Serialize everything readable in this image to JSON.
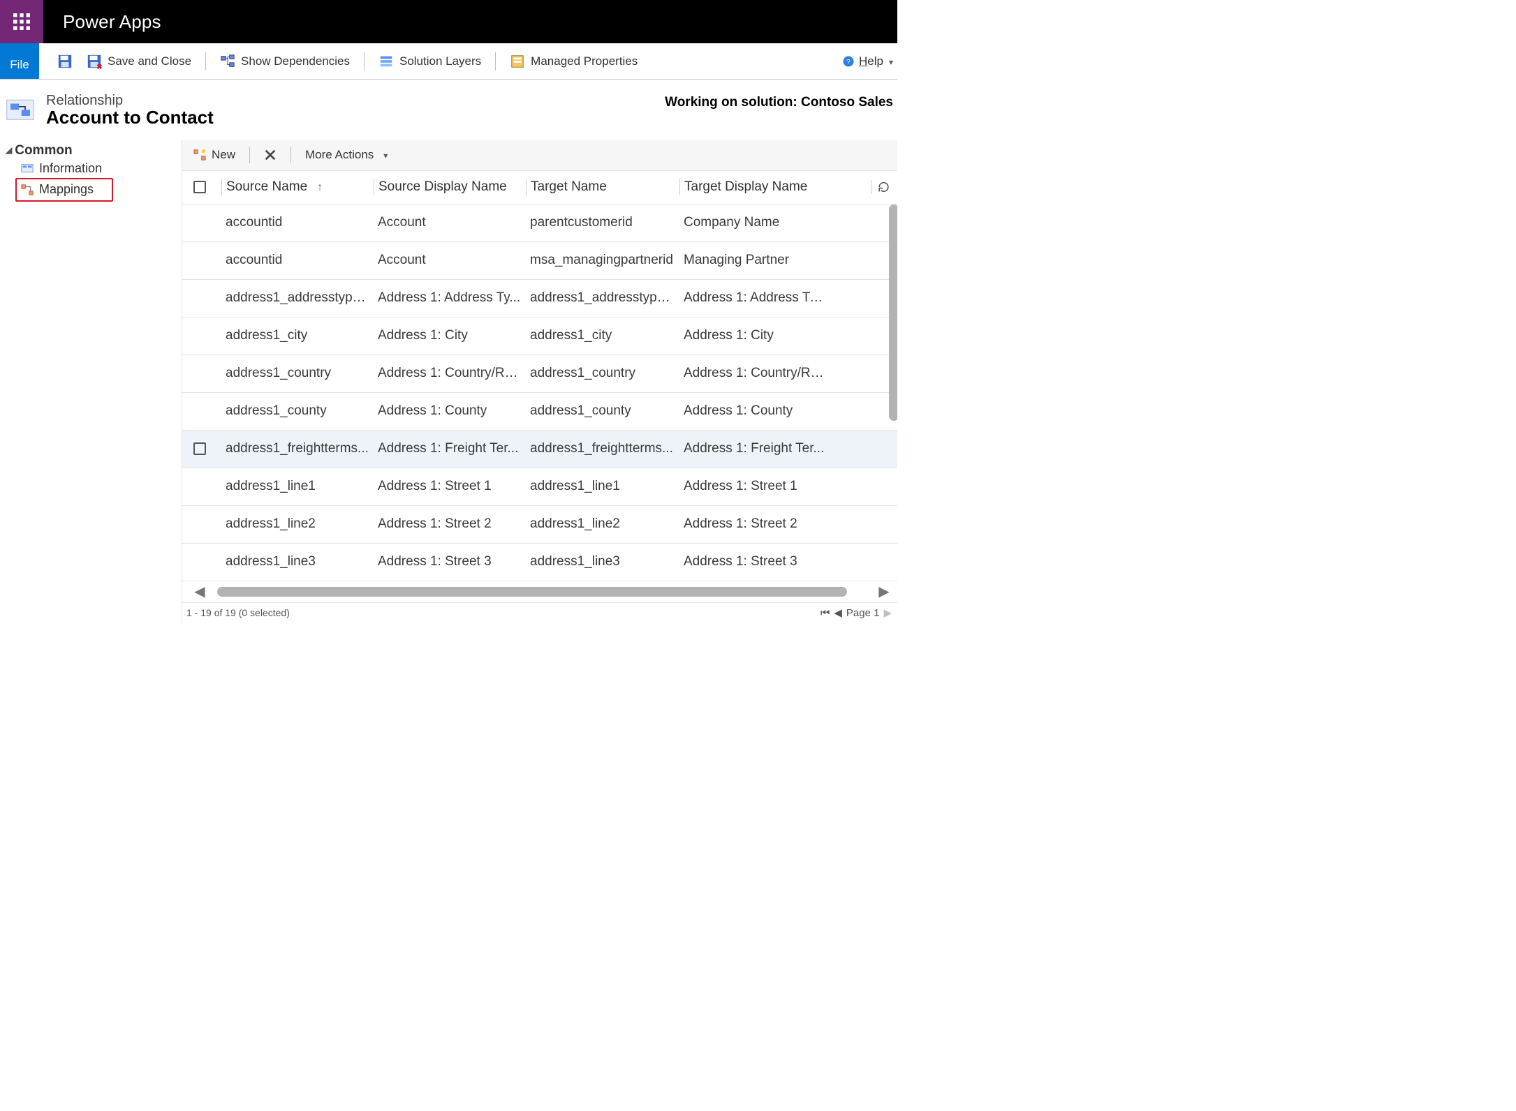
{
  "app_title": "Power Apps",
  "ribbon": {
    "file": "File",
    "save": "",
    "save_close": "Save and Close",
    "deps": "Show Dependencies",
    "layers": "Solution Layers",
    "props": "Managed Properties",
    "help": "Help"
  },
  "header": {
    "subtitle": "Relationship",
    "title": "Account to Contact",
    "solution_prefix": "Working on solution: ",
    "solution_name": "Contoso Sales"
  },
  "nav": {
    "group": "Common",
    "items": [
      "Information",
      "Mappings"
    ],
    "selected": 1
  },
  "grid_toolbar": {
    "new": "New",
    "more": "More Actions"
  },
  "grid": {
    "columns": [
      "Source Name",
      "Source Display Name",
      "Target Name",
      "Target Display Name"
    ],
    "sort_col": 0,
    "rows": [
      {
        "sn": "accountid",
        "sdn": "Account",
        "tn": "parentcustomerid",
        "tdn": "Company Name"
      },
      {
        "sn": "accountid",
        "sdn": "Account",
        "tn": "msa_managingpartnerid",
        "tdn": "Managing Partner"
      },
      {
        "sn": "address1_addresstype...",
        "sdn": "Address 1: Address Ty...",
        "tn": "address1_addresstype...",
        "tdn": "Address 1: Address Ty..."
      },
      {
        "sn": "address1_city",
        "sdn": "Address 1: City",
        "tn": "address1_city",
        "tdn": "Address 1: City"
      },
      {
        "sn": "address1_country",
        "sdn": "Address 1: Country/Re...",
        "tn": "address1_country",
        "tdn": "Address 1: Country/Re..."
      },
      {
        "sn": "address1_county",
        "sdn": "Address 1: County",
        "tn": "address1_county",
        "tdn": "Address 1: County"
      },
      {
        "sn": "address1_freightterms...",
        "sdn": "Address 1: Freight Ter...",
        "tn": "address1_freightterms...",
        "tdn": "Address 1: Freight Ter...",
        "hover": true
      },
      {
        "sn": "address1_line1",
        "sdn": "Address 1: Street 1",
        "tn": "address1_line1",
        "tdn": "Address 1: Street 1"
      },
      {
        "sn": "address1_line2",
        "sdn": "Address 1: Street 2",
        "tn": "address1_line2",
        "tdn": "Address 1: Street 2"
      },
      {
        "sn": "address1_line3",
        "sdn": "Address 1: Street 3",
        "tn": "address1_line3",
        "tdn": "Address 1: Street 3"
      }
    ],
    "status": "1 - 19 of 19 (0 selected)",
    "page_label": "Page 1"
  }
}
